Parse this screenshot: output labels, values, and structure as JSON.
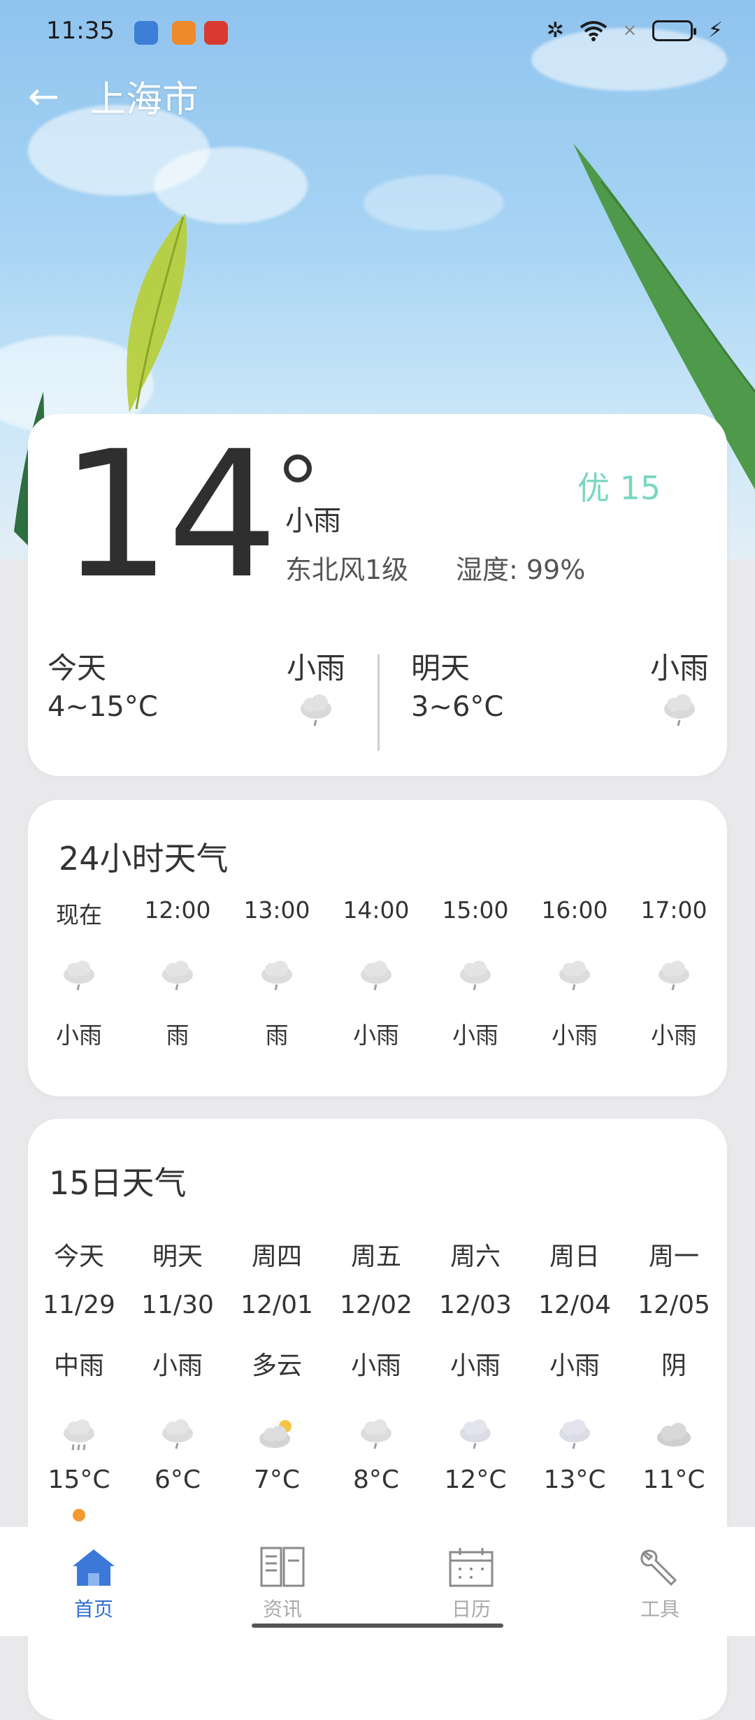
{
  "status_bar": {
    "time": "11:35",
    "icons": [
      "bluetooth-icon",
      "wifi-icon",
      "no-signal-icon",
      "battery-icon",
      "charging-icon"
    ]
  },
  "header": {
    "city": "上海市"
  },
  "current": {
    "temperature": "14",
    "condition": "小雨",
    "wind": "东北风1级",
    "humidity": "湿度: 99%",
    "aqi": "优 15",
    "aqi_color": "#7ad6c2"
  },
  "today": {
    "label": "今天",
    "range": "4~15°C",
    "condition": "小雨"
  },
  "tomorrow": {
    "label": "明天",
    "range": "3~6°C",
    "condition": "小雨"
  },
  "hourly": {
    "title": "24小时天气",
    "items": [
      {
        "time": "现在",
        "condition": "小雨"
      },
      {
        "time": "12:00",
        "condition": "雨"
      },
      {
        "time": "13:00",
        "condition": "雨"
      },
      {
        "time": "14:00",
        "condition": "小雨"
      },
      {
        "time": "15:00",
        "condition": "小雨"
      },
      {
        "time": "16:00",
        "condition": "小雨"
      },
      {
        "time": "17:00",
        "condition": "小雨"
      }
    ]
  },
  "daily": {
    "title": "15日天气",
    "items": [
      {
        "day": "今天",
        "date": "11/29",
        "condition": "中雨",
        "temp": "15°C"
      },
      {
        "day": "明天",
        "date": "11/30",
        "condition": "小雨",
        "temp": "6°C"
      },
      {
        "day": "周四",
        "date": "12/01",
        "condition": "多云",
        "temp": "7°C"
      },
      {
        "day": "周五",
        "date": "12/02",
        "condition": "小雨",
        "temp": "8°C"
      },
      {
        "day": "周六",
        "date": "12/03",
        "condition": "小雨",
        "temp": "12°C"
      },
      {
        "day": "周日",
        "date": "12/04",
        "condition": "小雨",
        "temp": "13°C"
      },
      {
        "day": "周一",
        "date": "12/05",
        "condition": "阴",
        "temp": "11°C"
      }
    ]
  },
  "nav": {
    "items": [
      {
        "label": "首页",
        "icon": "home-icon",
        "active": true
      },
      {
        "label": "资讯",
        "icon": "news-icon",
        "active": false
      },
      {
        "label": "日历",
        "icon": "calendar-icon",
        "active": false
      },
      {
        "label": "工具",
        "icon": "tools-icon",
        "active": false
      }
    ],
    "active_color": "#2f6fd0"
  }
}
